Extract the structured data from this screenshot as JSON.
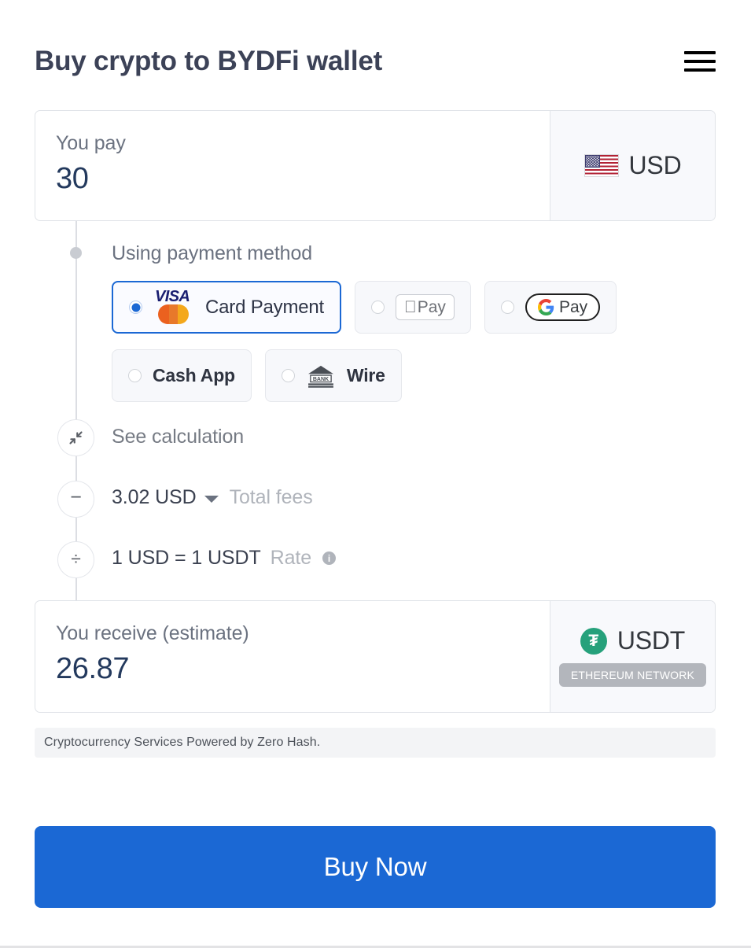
{
  "header": {
    "title": "Buy crypto to BYDFi wallet",
    "menu_icon": "hamburger-icon"
  },
  "pay": {
    "label": "You pay",
    "value": "30",
    "currency": "USD",
    "flag_icon": "us-flag-icon"
  },
  "payment_method": {
    "heading": "Using payment method",
    "options": [
      {
        "id": "card",
        "label": "Card Payment",
        "selected": true,
        "icons": [
          "visa-logo",
          "mastercard-logo"
        ]
      },
      {
        "id": "apple_pay",
        "label": "Pay",
        "selected": false,
        "icons": [
          "apple-pay-logo"
        ]
      },
      {
        "id": "google_pay",
        "label": "Pay",
        "selected": false,
        "icons": [
          "google-pay-logo"
        ]
      },
      {
        "id": "cash_app",
        "label": "Cash App",
        "selected": false,
        "icons": []
      },
      {
        "id": "wire",
        "label": "Wire",
        "selected": false,
        "icons": [
          "bank-icon"
        ]
      }
    ]
  },
  "calculation": {
    "see_calculation_label": "See calculation",
    "collapse_icon": "collapse-arrows-icon",
    "fees": {
      "operator_icon": "minus-icon",
      "amount": "3.02 USD",
      "label": "Total fees",
      "caret_icon": "caret-down-icon"
    },
    "rate": {
      "operator_icon": "divide-icon",
      "value": "1 USD = 1 USDT",
      "label": "Rate",
      "info_icon": "info-icon"
    }
  },
  "receive": {
    "label": "You receive (estimate)",
    "value": "26.87",
    "currency": "USDT",
    "token_icon": "usdt-token-icon",
    "token_symbol": "₮",
    "network_badge": "ETHEREUM NETWORK"
  },
  "note": {
    "text": "Cryptocurrency Services Powered by Zero Hash."
  },
  "cta": {
    "label": "Buy Now"
  },
  "colors": {
    "accent_blue": "#1b68d4",
    "title_text": "#3c4257",
    "value_navy": "#23395d",
    "muted_text": "#b0b4bb",
    "usdt_green": "#26a17b",
    "badge_gray": "#b3b6bc"
  }
}
